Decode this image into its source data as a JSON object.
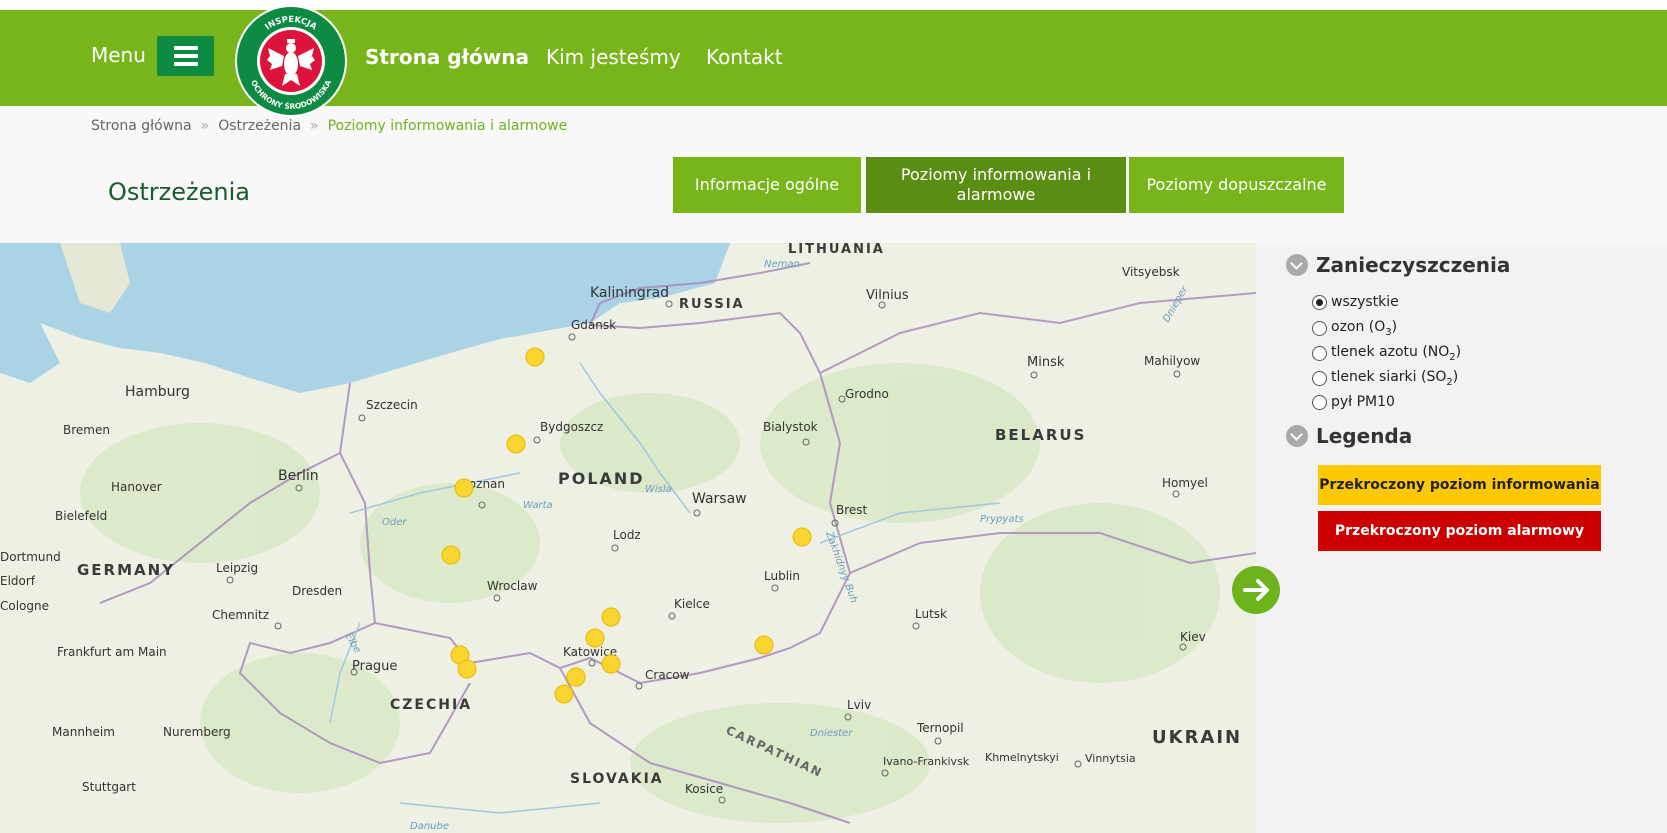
{
  "header": {
    "menu_label": "Menu",
    "logo_text_top": "INSPEKCJA",
    "logo_text_bottom": "OCHRONY ŚRODOWISKA",
    "nav": [
      {
        "label": "Strona główna",
        "active": true
      },
      {
        "label": "Kim jesteśmy"
      },
      {
        "label": "Kontakt"
      }
    ],
    "brand_color": "#78b51a"
  },
  "breadcrumb": [
    "Strona główna",
    "Ostrzeżenia",
    "Poziomy informowania i alarmowe"
  ],
  "page_title": "Ostrzeżenia",
  "tabs": [
    {
      "label": "Informacje ogólne"
    },
    {
      "label": "Poziomy informowania i alarmowe",
      "active": true
    },
    {
      "label": "Poziomy dopuszczalne"
    }
  ],
  "panel": {
    "pollutants_title": "Zanieczyszczenia",
    "options": [
      {
        "label": "wszystkie",
        "selected": true
      },
      {
        "label": "ozon (O",
        "sub": "3",
        "tail": ")"
      },
      {
        "label": "tlenek azotu (NO",
        "sub": "2",
        "tail": ")"
      },
      {
        "label": "tlenek siarki (SO",
        "sub": "2",
        "tail": ")"
      },
      {
        "label": "pył PM10"
      }
    ],
    "legend_title": "Legenda",
    "legend": [
      {
        "label": "Przekroczony poziom informowania",
        "color": "#fcc800"
      },
      {
        "label": "Przekroczony poziom alarmowy",
        "color": "#cc0000"
      }
    ]
  },
  "map": {
    "countries": [
      "LITHUANIA",
      "RUSSIA",
      "BELARUS",
      "POLAND",
      "GERMANY",
      "CZECHIA",
      "SLOVAKIA",
      "UKRAIN",
      "CARPATHIAN"
    ],
    "cities": [
      "Kaliningrad",
      "Vilnius",
      "Vitsyebsk",
      "Gdansk",
      "Minsk",
      "Mahilyow",
      "Hamburg",
      "Szczecin",
      "Bydgoszcz",
      "Bialystok",
      "Grodno",
      "Bremen",
      "Berlin",
      "Poznan",
      "Warsaw",
      "Hanover",
      "Brest",
      "Homyel",
      "Bielefeld",
      "Lodz",
      "Dortmund",
      "Leipzig",
      "Lublin",
      "Wroclaw",
      "Dresden",
      "Kielce",
      "Chemnitz",
      "Lutsk",
      "Kiev",
      "Katowice",
      "Cracow",
      "Prague",
      "Frankfurt am Main",
      "Lviv",
      "Ternopil",
      "Mannheim",
      "Nuremberg",
      "Ivano-Frankivsk",
      "Khmelnytskyi",
      "Vinnytsia",
      "Stuttgart",
      "Kosice",
      "Eldorf",
      "Cologne"
    ],
    "rivers": [
      "Neman",
      "Wisla",
      "Warta",
      "Oder",
      "Elbe",
      "Danube",
      "Dniester",
      "Prypyats",
      "Zakhidnyy Buh",
      "Dnieper"
    ],
    "marker_color": "#fbd52f",
    "marker_count": 14
  }
}
